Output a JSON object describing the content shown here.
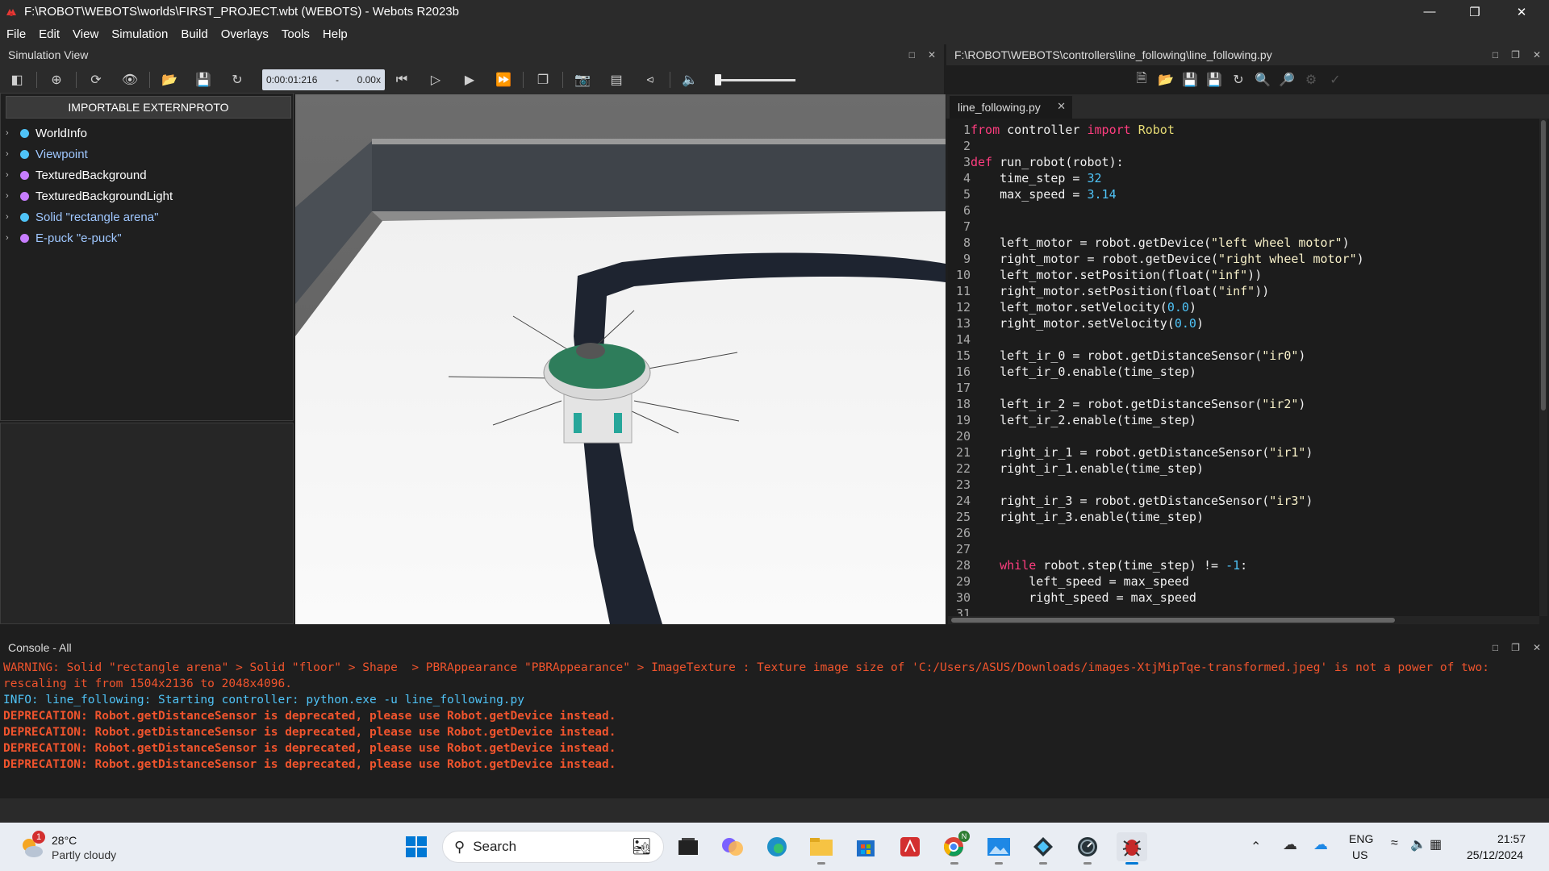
{
  "window": {
    "title": "F:\\ROBOT\\WEBOTS\\worlds\\FIRST_PROJECT.wbt (WEBOTS) - Webots R2023b",
    "min_icon": "minimize-icon",
    "max_icon": "restore-icon",
    "close_icon": "close-icon"
  },
  "menu": [
    "File",
    "Edit",
    "View",
    "Simulation",
    "Build",
    "Overlays",
    "Tools",
    "Help"
  ],
  "simulation_view": {
    "title": "Simulation View",
    "time": "0:00:01:216",
    "speed_sep": "-",
    "speed": "0.00x"
  },
  "scene_tree": {
    "externproto_button": "IMPORTABLE EXTERNPROTO",
    "items": [
      {
        "label": "WorldInfo",
        "color": "#4fc3f7",
        "text_color": "#ffffff"
      },
      {
        "label": "Viewpoint",
        "color": "#4fc3f7",
        "text_color": "#9fc7ff"
      },
      {
        "label": "TexturedBackground",
        "color": "#c77dff",
        "text_color": "#ffffff"
      },
      {
        "label": "TexturedBackgroundLight",
        "color": "#c77dff",
        "text_color": "#ffffff"
      },
      {
        "label": "Solid \"rectangle arena\"",
        "color": "#4fc3f7",
        "text_color": "#9fc7ff"
      },
      {
        "label": "E-puck \"e-puck\"",
        "color": "#c77dff",
        "text_color": "#9fc7ff"
      }
    ]
  },
  "editor": {
    "path": "F:\\ROBOT\\WEBOTS\\controllers\\line_following\\line_following.py",
    "tab": "line_following.py",
    "lines": [
      {
        "n": "1",
        "code": "from controller import Robot"
      },
      {
        "n": "2",
        "code": ""
      },
      {
        "n": "3",
        "code": "def run_robot(robot):"
      },
      {
        "n": "4",
        "code": "    time_step = 32"
      },
      {
        "n": "5",
        "code": "    max_speed = 3.14"
      },
      {
        "n": "6",
        "code": ""
      },
      {
        "n": "7",
        "code": ""
      },
      {
        "n": "8",
        "code": "    left_motor = robot.getDevice(\"left wheel motor\")"
      },
      {
        "n": "9",
        "code": "    right_motor = robot.getDevice(\"right wheel motor\")"
      },
      {
        "n": "10",
        "code": "    left_motor.setPosition(float(\"inf\"))"
      },
      {
        "n": "11",
        "code": "    right_motor.setPosition(float(\"inf\"))"
      },
      {
        "n": "12",
        "code": "    left_motor.setVelocity(0.0)"
      },
      {
        "n": "13",
        "code": "    right_motor.setVelocity(0.0)"
      },
      {
        "n": "14",
        "code": ""
      },
      {
        "n": "15",
        "code": "    left_ir_0 = robot.getDistanceSensor(\"ir0\")"
      },
      {
        "n": "16",
        "code": "    left_ir_0.enable(time_step)"
      },
      {
        "n": "17",
        "code": ""
      },
      {
        "n": "18",
        "code": "    left_ir_2 = robot.getDistanceSensor(\"ir2\")"
      },
      {
        "n": "19",
        "code": "    left_ir_2.enable(time_step)"
      },
      {
        "n": "20",
        "code": ""
      },
      {
        "n": "21",
        "code": "    right_ir_1 = robot.getDistanceSensor(\"ir1\")"
      },
      {
        "n": "22",
        "code": "    right_ir_1.enable(time_step)"
      },
      {
        "n": "23",
        "code": ""
      },
      {
        "n": "24",
        "code": "    right_ir_3 = robot.getDistanceSensor(\"ir3\")"
      },
      {
        "n": "25",
        "code": "    right_ir_3.enable(time_step)"
      },
      {
        "n": "26",
        "code": ""
      },
      {
        "n": "27",
        "code": ""
      },
      {
        "n": "28",
        "code": "    while robot.step(time_step) != -1:"
      },
      {
        "n": "29",
        "code": "        left_speed = max_speed"
      },
      {
        "n": "30",
        "code": "        right_speed = max_speed"
      },
      {
        "n": "31",
        "code": ""
      }
    ]
  },
  "console": {
    "title": "Console - All",
    "lines": [
      {
        "type": "warn",
        "text": "WARNING: Solid \"rectangle arena\" > Solid \"floor\" > Shape  > PBRAppearance \"PBRAppearance\" > ImageTexture : Texture image size of 'C:/Users/ASUS/Downloads/images-XtjMipTqe-transformed.jpeg' is not a power of two:"
      },
      {
        "type": "warn",
        "text": "rescaling it from 1504x2136 to 2048x4096."
      },
      {
        "type": "info",
        "text": "INFO: line_following: Starting controller: python.exe -u line_following.py"
      },
      {
        "type": "dep",
        "text": "DEPRECATION: Robot.getDistanceSensor is deprecated, please use Robot.getDevice instead."
      },
      {
        "type": "dep",
        "text": "DEPRECATION: Robot.getDistanceSensor is deprecated, please use Robot.getDevice instead."
      },
      {
        "type": "dep",
        "text": "DEPRECATION: Robot.getDistanceSensor is deprecated, please use Robot.getDevice instead."
      },
      {
        "type": "dep",
        "text": "DEPRECATION: Robot.getDistanceSensor is deprecated, please use Robot.getDevice instead."
      }
    ]
  },
  "taskbar": {
    "weather_temp": "28°C",
    "weather_desc": "Partly cloudy",
    "weather_badge": "1",
    "search_placeholder": "Search",
    "lang1": "ENG",
    "lang2": "US",
    "time": "21:57",
    "date": "25/12/2024",
    "chrome_badge": "N"
  },
  "colors": {
    "keyword": "#ff3d7f",
    "number": "#4fc3f7",
    "warning": "#f0542d",
    "info": "#4fc3f7",
    "accent": "#0078d4"
  }
}
